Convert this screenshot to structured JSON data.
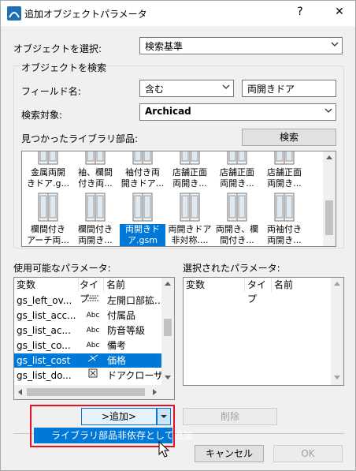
{
  "window": {
    "title": "追加オブジェクトパラメータ",
    "help": "?",
    "close": "✕"
  },
  "select_object": {
    "label": "オブジェクトを選択:",
    "value": "検索基準"
  },
  "search_group": {
    "title": "オブジェクトを検索",
    "field_label": "フィールド名:",
    "condition_value": "含む",
    "search_text": "両開きドア",
    "target_label": "検索対象:",
    "target_value": "Archicad",
    "found_label": "見つかったライブラリ部品:",
    "search_button": "検索"
  },
  "library_items": [
    {
      "line1": "金属両開",
      "line2": "きドア.g..."
    },
    {
      "line1": "袖、欄間",
      "line2": "付き両..."
    },
    {
      "line1": "袖付き両",
      "line2": "開きドア..."
    },
    {
      "line1": "店舗正面",
      "line2": "両開き..."
    },
    {
      "line1": "店舗正面",
      "line2": "両開き..."
    },
    {
      "line1": "店舗正面",
      "line2": "両開き..."
    },
    {
      "line1": "欄間付き",
      "line2": "アーチ両..."
    },
    {
      "line1": "欄間付き",
      "line2": "両開き..."
    },
    {
      "line1": "両開きド",
      "line2": "ア.gsm"
    },
    {
      "line1": "両開きドア",
      "line2": "非対称...."
    },
    {
      "line1": "両開き、欄",
      "line2": "間付き..."
    },
    {
      "line1": "両袖付き",
      "line2": "両開き..."
    }
  ],
  "available_params": {
    "label": "使用可能なパラメータ:",
    "headers": [
      "変数",
      "タイプ",
      "名前"
    ],
    "rows": [
      {
        "var": "gs_left_ov...",
        "type": "dim-icon",
        "name": "左開口部拡..."
      },
      {
        "var": "gs_list_acc...",
        "type": "Abc",
        "name": "付属品"
      },
      {
        "var": "gs_list_ac...",
        "type": "Abc",
        "name": "防音等級"
      },
      {
        "var": "gs_list_co...",
        "type": "Abc",
        "name": "備考"
      },
      {
        "var": "gs_list_cost",
        "type": "ruler-icon",
        "name": "価格"
      },
      {
        "var": "gs_list_do...",
        "type": "checkbox-icon",
        "name": "ドアクローザ"
      }
    ]
  },
  "selected_params": {
    "label": "選択されたパラメータ:",
    "headers": [
      "変数",
      "タイプ",
      "名前"
    ]
  },
  "add_button": ">追加>",
  "delete_button": "削除",
  "dropdown_item": "ライブラリ部品非依存として追加",
  "cancel_button": "キャンセル",
  "ok_button": "OK",
  "colors": {
    "accent": "#0078d7",
    "highlight_frame": "#e81123"
  }
}
